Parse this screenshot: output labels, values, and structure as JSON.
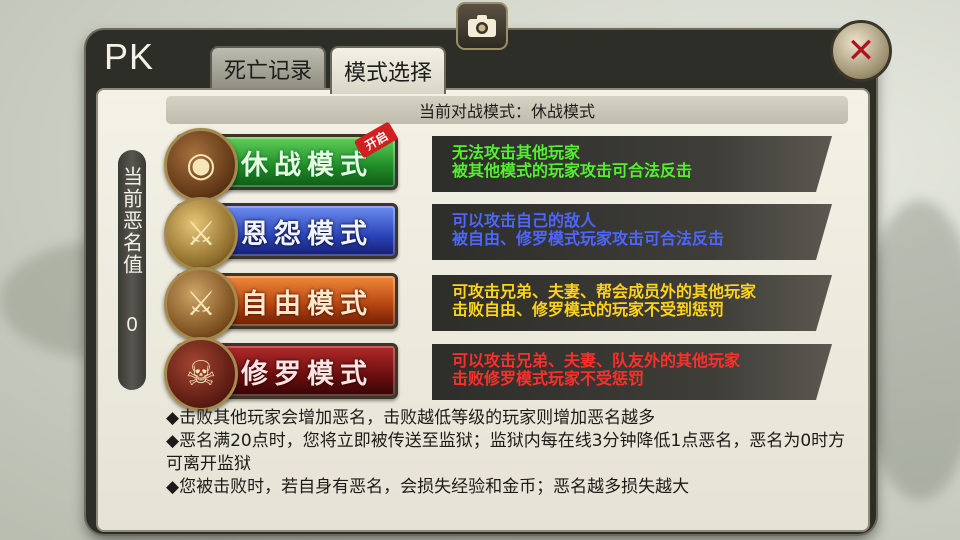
{
  "title": "PK",
  "tabs": [
    {
      "label": "死亡记录"
    },
    {
      "label": "模式选择"
    }
  ],
  "current_mode_text": "当前对战模式：休战模式",
  "evil": {
    "label": "当前恶名值",
    "value": "0"
  },
  "modes": [
    {
      "label": "休战模式",
      "lines": [
        "无法攻击其他玩家",
        "被其他模式的玩家攻击可合法反击"
      ],
      "color": "#52f02e",
      "icon": "shield-icon",
      "badge": "开启"
    },
    {
      "label": "恩怨模式",
      "lines": [
        "可以攻击自己的敌人",
        "被自由、修罗模式玩家攻击可合法反击"
      ],
      "color": "#4c66ff",
      "icon": "helmet-swords-icon"
    },
    {
      "label": "自由模式",
      "lines": [
        "可攻击兄弟、夫妻、帮会成员外的其他玩家",
        "击败自由、修罗模式的玩家不受到惩罚"
      ],
      "color": "#ffd21c",
      "icon": "crossed-swords-icon"
    },
    {
      "label": "修罗模式",
      "lines": [
        "可以攻击兄弟、夫妻、队友外的其他玩家",
        "击败修罗模式玩家不受惩罚"
      ],
      "color": "#ff2f2a",
      "icon": "demon-mask-icon"
    }
  ],
  "rules": [
    "◆击败其他玩家会增加恶名，击败越低等级的玩家则增加恶名越多",
    "◆恶名满20点时，您将立即被传送至监狱；监狱内每在线3分钟降低1点恶名，恶名为0时方可离开监狱",
    "◆您被击败时，若自身有恶名，会损失经验和金币；恶名越多损失越大"
  ],
  "icons": {
    "camera": "camera-icon",
    "close": "close-icon"
  }
}
